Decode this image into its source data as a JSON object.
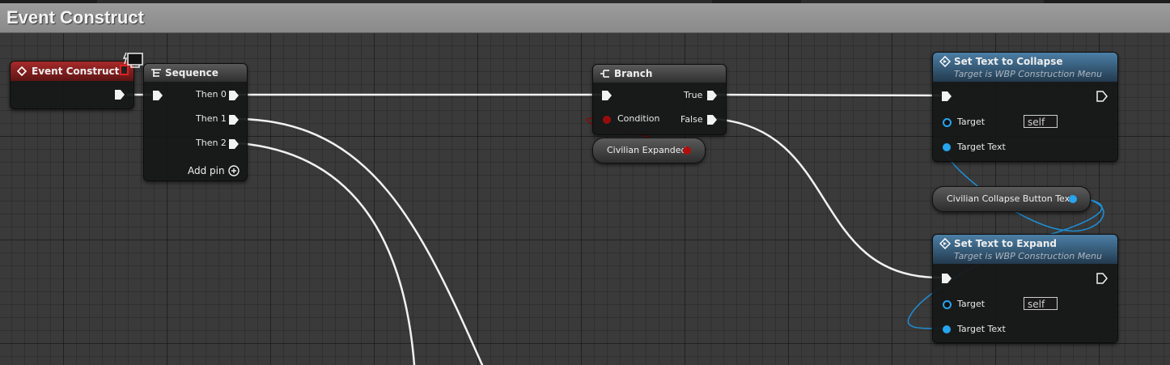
{
  "graph": {
    "title": "Event Construct"
  },
  "nodes": {
    "event_construct": {
      "title": "Event Construct",
      "color": "#8b1c1c"
    },
    "sequence": {
      "title": "Sequence",
      "pins": [
        "Then 0",
        "Then 1",
        "Then 2"
      ],
      "add_pin": "Add pin"
    },
    "branch": {
      "title": "Branch",
      "condition": "Condition",
      "true": "True",
      "false": "False"
    },
    "civilian_expanded": {
      "label": "Civilian Expanded",
      "pin_color": "#9a0c0c"
    },
    "set_text_collapse": {
      "title": "Set Text to Collapse",
      "subtitle": "Target is WBP Construction Menu",
      "target": "Target",
      "target_value": "self",
      "target_text": "Target Text"
    },
    "civilian_collapse_text": {
      "label": "Civilian Collapse Button Text",
      "pin_color": "#1e9ee8"
    },
    "set_text_expand": {
      "title": "Set Text to Expand",
      "subtitle": "Target is WBP Construction Menu",
      "target": "Target",
      "target_value": "self",
      "target_text": "Target Text"
    }
  },
  "icons": {
    "event": "diamond-icon",
    "sequence": "sequence-icon",
    "branch": "branch-icon",
    "function": "function-icon",
    "client": "client-monitor-icon"
  }
}
